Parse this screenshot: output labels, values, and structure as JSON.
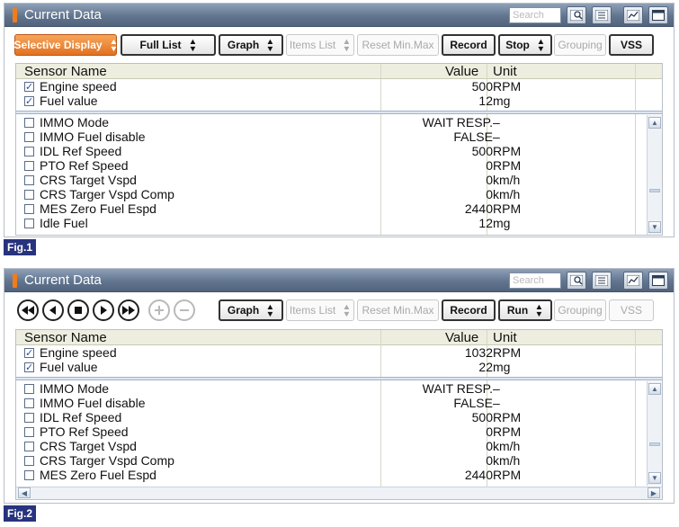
{
  "panel1": {
    "title": "Current Data",
    "search_placeholder": "Search",
    "toolbar": {
      "selective_display": "Selective Display",
      "list_mode": "Full List",
      "graph": "Graph",
      "items_list": "Items List",
      "reset_minmax": "Reset Min.Max",
      "record": "Record",
      "stop": "Stop",
      "grouping": "Grouping",
      "vss": "VSS"
    },
    "headers": {
      "name": "Sensor Name",
      "value": "Value",
      "unit": "Unit"
    },
    "selected_rows": [
      {
        "checked": true,
        "name": "Engine speed",
        "value": "500",
        "unit": "RPM"
      },
      {
        "checked": true,
        "name": "Fuel value",
        "value": "12",
        "unit": "mg"
      }
    ],
    "rows": [
      {
        "checked": false,
        "name": "IMMO Mode",
        "value": "WAIT RESP.",
        "unit": "–"
      },
      {
        "checked": false,
        "name": "IMMO Fuel disable",
        "value": "FALSE",
        "unit": "–"
      },
      {
        "checked": false,
        "name": "IDL Ref Speed",
        "value": "500",
        "unit": "RPM"
      },
      {
        "checked": false,
        "name": "PTO Ref Speed",
        "value": "0",
        "unit": "RPM"
      },
      {
        "checked": false,
        "name": "CRS Target Vspd",
        "value": "0",
        "unit": "km/h"
      },
      {
        "checked": false,
        "name": "CRS Targer Vspd Comp",
        "value": "0",
        "unit": "km/h"
      },
      {
        "checked": false,
        "name": "MES Zero Fuel Espd",
        "value": "2440",
        "unit": "RPM"
      },
      {
        "checked": false,
        "name": "Idle Fuel",
        "value": "12",
        "unit": "mg"
      }
    ],
    "fig_label": "Fig.1"
  },
  "panel2": {
    "title": "Current Data",
    "search_placeholder": "Search",
    "toolbar": {
      "graph": "Graph",
      "items_list": "Items List",
      "reset_minmax": "Reset Min.Max",
      "record": "Record",
      "run": "Run",
      "grouping": "Grouping",
      "vss": "VSS"
    },
    "headers": {
      "name": "Sensor Name",
      "value": "Value",
      "unit": "Unit"
    },
    "selected_rows": [
      {
        "checked": true,
        "name": "Engine speed",
        "value": "1032",
        "unit": "RPM"
      },
      {
        "checked": true,
        "name": "Fuel value",
        "value": "22",
        "unit": "mg"
      }
    ],
    "rows": [
      {
        "checked": false,
        "name": "IMMO Mode",
        "value": "WAIT RESP.",
        "unit": "–"
      },
      {
        "checked": false,
        "name": "IMMO Fuel disable",
        "value": "FALSE",
        "unit": "–"
      },
      {
        "checked": false,
        "name": "IDL Ref Speed",
        "value": "500",
        "unit": "RPM"
      },
      {
        "checked": false,
        "name": "PTO Ref Speed",
        "value": "0",
        "unit": "RPM"
      },
      {
        "checked": false,
        "name": "CRS Target Vspd",
        "value": "0",
        "unit": "km/h"
      },
      {
        "checked": false,
        "name": "CRS Targer Vspd Comp",
        "value": "0",
        "unit": "km/h"
      },
      {
        "checked": false,
        "name": "MES Zero Fuel Espd",
        "value": "2440",
        "unit": "RPM"
      }
    ],
    "fig_label": "Fig.2"
  },
  "colors": {
    "accent_orange": "#e27120",
    "title_bar": "#62758f",
    "fig_label_bg": "#27337e"
  }
}
